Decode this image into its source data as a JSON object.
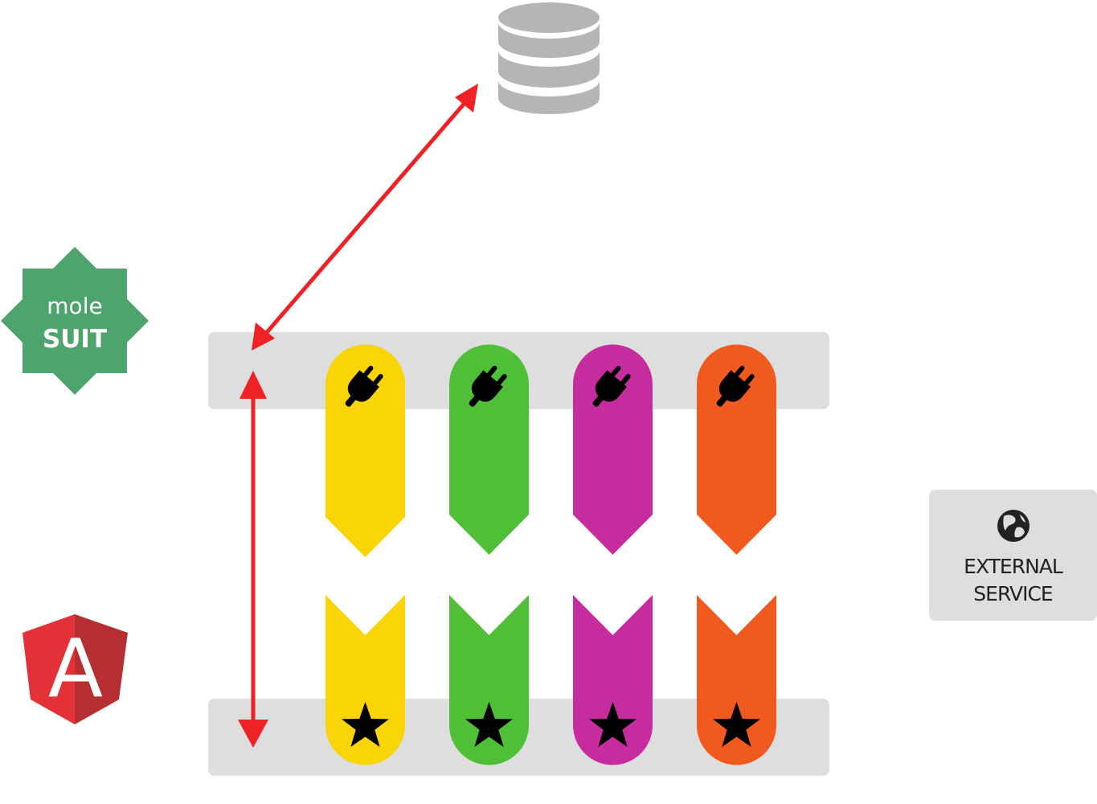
{
  "logos": {
    "mole_suit": {
      "line1": "mole",
      "line2": "SUIT",
      "color": "#4da46d"
    },
    "angular": {
      "letter": "A",
      "color_light": "#e23237",
      "color_dark": "#b52e31"
    }
  },
  "database": {
    "icon": "database-icon",
    "color": "#b5b5b5"
  },
  "external_service": {
    "line1": "EXTERNAL",
    "line2": "SERVICE",
    "icon": "globe-icon"
  },
  "layers": {
    "color": "#dddedd"
  },
  "connectors": {
    "color": "#ee2124",
    "items": [
      {
        "from": "top-layer",
        "to": "database",
        "direction": "both"
      },
      {
        "from": "top-layer",
        "to": "bottom-layer",
        "direction": "both"
      }
    ]
  },
  "modules": [
    {
      "color": "#f9d508",
      "top_icon": "plug-icon",
      "bottom_icon": "star-icon"
    },
    {
      "color": "#4fbf38",
      "top_icon": "plug-icon",
      "bottom_icon": "star-icon"
    },
    {
      "color": "#c72c9e",
      "top_icon": "plug-icon",
      "bottom_icon": "star-icon"
    },
    {
      "color": "#f15a1f",
      "top_icon": "plug-icon",
      "bottom_icon": "star-icon"
    }
  ]
}
